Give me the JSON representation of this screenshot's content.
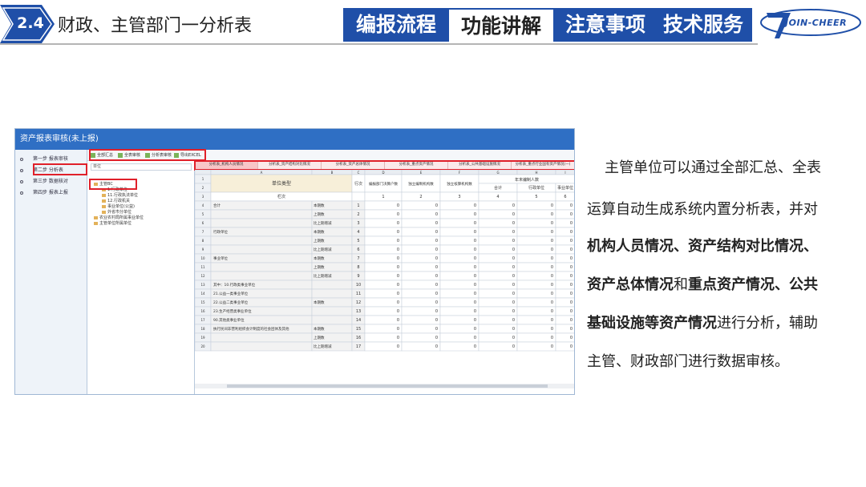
{
  "header": {
    "section_number": "2.4",
    "section_title": "财政、主管部门一分析表",
    "nav_items": [
      "编报流程",
      "功能讲解",
      "注意事项",
      "技术服务"
    ],
    "active_nav": "功能讲解",
    "logo_text": "JOIN-CHEER"
  },
  "app": {
    "window_title": "资产报表审核(未上报)",
    "steps": [
      "第一步 报表审核",
      "第二步 分析表",
      "第三步 数据核对",
      "第四步 报表上报"
    ],
    "toolbar": [
      "全部汇总",
      "全表审核",
      "分析表审核",
      "导出EXCEL"
    ],
    "tree_search": "单位",
    "tree_items": [
      "主管BC",
      "1.行政单位",
      "11.行政执法单位",
      "12.行政机关",
      "事业单位(公益)",
      "外省市分单位",
      "农业农村局所属事业单位",
      "主管单位所属单位"
    ],
    "tabs": [
      "分析表_机构人员情况",
      "分析表_资产结构对比情况",
      "分析表_资产总体情况",
      "分析表_重点资产情况",
      "分析表_公共基础设施情况",
      "分析表_重点行业国有资产情况(一)"
    ],
    "grid": {
      "col_letters": [
        "A",
        "B",
        "C",
        "D",
        "E",
        "F",
        "G",
        "H",
        "I"
      ],
      "headers": [
        "单位类型",
        "",
        "行次",
        "编报部门决算户数",
        "独立编制机构数",
        "独立核算机构数",
        "合计",
        "行政单位",
        "事业单位"
      ],
      "group_header": "年末编制人数",
      "rowlabel_header": "栏次",
      "col_nums": [
        "",
        "",
        "",
        "1",
        "2",
        "3",
        "4",
        "5",
        "6"
      ],
      "rows": [
        {
          "n": "4",
          "label": "合计",
          "sub": "本期数",
          "line": "1"
        },
        {
          "n": "5",
          "label": "",
          "sub": "上期数",
          "line": "2"
        },
        {
          "n": "6",
          "label": "",
          "sub": "比上期增减",
          "line": "3"
        },
        {
          "n": "7",
          "label": "行政单位",
          "sub": "本期数",
          "line": "4"
        },
        {
          "n": "8",
          "label": "",
          "sub": "上期数",
          "line": "5"
        },
        {
          "n": "9",
          "label": "",
          "sub": "比上期增减",
          "line": "6"
        },
        {
          "n": "10",
          "label": "事业单位",
          "sub": "本期数",
          "line": "7"
        },
        {
          "n": "11",
          "label": "",
          "sub": "上期数",
          "line": "8"
        },
        {
          "n": "12",
          "label": "",
          "sub": "比上期增减",
          "line": "9"
        },
        {
          "n": "13",
          "label": "其中：10.行政类事业单位",
          "sub": "",
          "line": "10"
        },
        {
          "n": "14",
          "label": "21.公益一类事业单位",
          "sub": "",
          "line": "11"
        },
        {
          "n": "15",
          "label": "22.公益二类事业单位",
          "sub": "本期数",
          "line": "12"
        },
        {
          "n": "16",
          "label": "23.生产经营类事业单位",
          "sub": "",
          "line": "13"
        },
        {
          "n": "17",
          "label": "90.其他类事业单位",
          "sub": "",
          "line": "14"
        },
        {
          "n": "18",
          "label": "执行民间非营利组织会计制度的社会团体及其他",
          "sub": "本期数",
          "line": "15"
        },
        {
          "n": "19",
          "label": "",
          "sub": "上期数",
          "line": "16"
        },
        {
          "n": "20",
          "label": "",
          "sub": "比上期增减",
          "line": "17"
        }
      ],
      "cell_value": "0"
    }
  },
  "description": {
    "lines": [
      [
        {
          "t": "主管单位可以通过全部汇总、全表",
          "b": false
        }
      ],
      [
        {
          "t": "运算自动生成系统内置分析表，并对",
          "b": false
        }
      ],
      [
        {
          "t": "机构人员情况、资产结构对比情况、",
          "b": true
        }
      ],
      [
        {
          "t": "资产总体情况",
          "b": true
        },
        {
          "t": "和",
          "b": false
        },
        {
          "t": "重点资产情况、公共",
          "b": true
        }
      ],
      [
        {
          "t": "基础设施等资产情况",
          "b": true
        },
        {
          "t": "进行分析，辅助",
          "b": false
        }
      ],
      [
        {
          "t": "主管、财政部门进行数据审核。",
          "b": false
        }
      ]
    ]
  },
  "colors": {
    "brand_blue": "#1f4fa8",
    "highlight_red": "#e0202a",
    "window_title": "#2f6fc4"
  }
}
